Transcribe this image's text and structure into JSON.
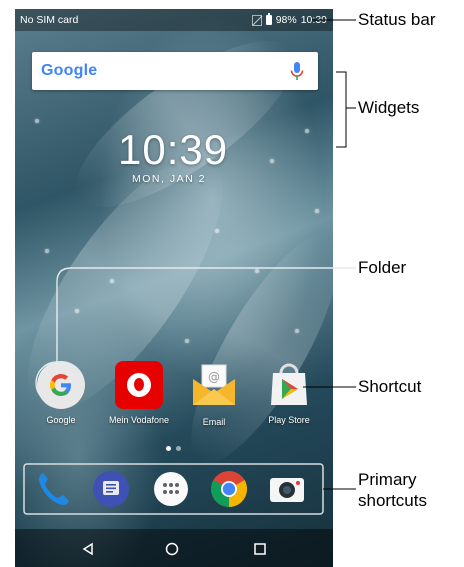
{
  "status_bar": {
    "carrier": "No SIM card",
    "battery": "98%",
    "time": "10:39"
  },
  "search_widget": {
    "logo": "Google",
    "icon": "mic-icon"
  },
  "clock_widget": {
    "time": "10:39",
    "date": "MON, JAN 2"
  },
  "home_apps": [
    {
      "label": "Google",
      "icon": "google-folder-icon"
    },
    {
      "label": "Mein Vodafone",
      "icon": "vodafone-icon"
    },
    {
      "label": "Email",
      "icon": "email-icon"
    },
    {
      "label": "Play Store",
      "icon": "play-store-icon"
    }
  ],
  "dock": [
    {
      "icon": "phone-icon"
    },
    {
      "icon": "messages-icon"
    },
    {
      "icon": "app-drawer-icon"
    },
    {
      "icon": "chrome-icon"
    },
    {
      "icon": "camera-icon"
    }
  ],
  "nav_bar": [
    "back-icon",
    "home-icon",
    "recents-icon"
  ],
  "callouts": {
    "status_bar": "Status bar",
    "widgets": "Widgets",
    "folder": "Folder",
    "shortcut": "Shortcut",
    "primary_line1": "Primary",
    "primary_line2": "shortcuts"
  },
  "colors": {
    "callout_line": "#000000",
    "highlight_box": "#d8dde0"
  }
}
